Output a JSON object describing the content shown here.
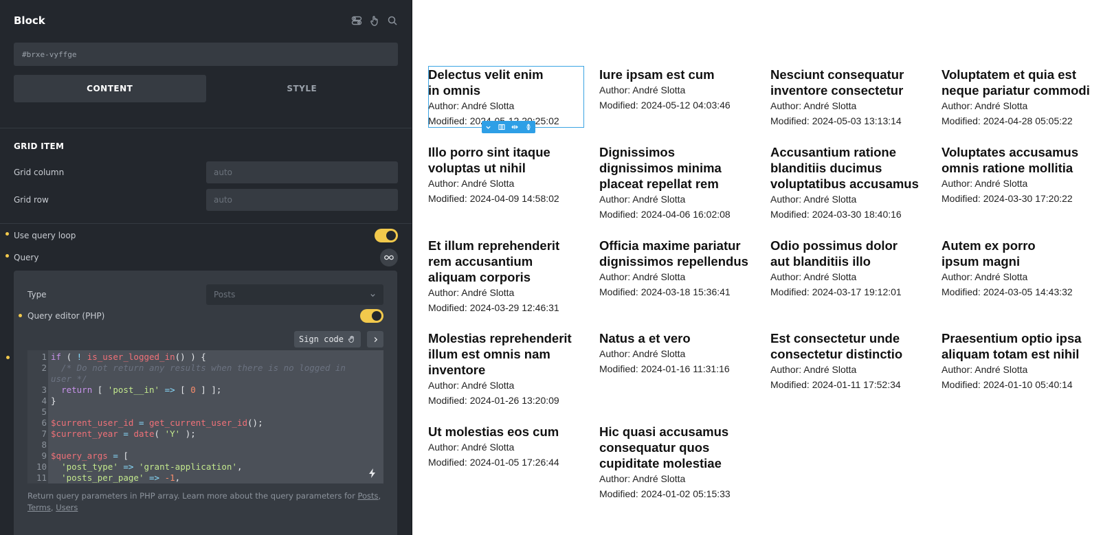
{
  "panel": {
    "title": "Block",
    "css_id": "#brxe-vyffge",
    "tabs": [
      {
        "label": "CONTENT"
      },
      {
        "label": "STYLE"
      }
    ],
    "grid_item": {
      "title": "GRID ITEM",
      "column_label": "Grid column",
      "column_placeholder": "auto",
      "row_label": "Grid row",
      "row_placeholder": "auto"
    },
    "use_query_loop": "Use query loop",
    "query": "Query",
    "type_label": "Type",
    "type_value": "Posts",
    "query_editor": "Query editor (PHP)",
    "sign_code": "Sign code",
    "help_text": "Return query parameters in PHP array. Learn more about the query parameters for",
    "help_links": [
      "Posts",
      "Terms",
      "Users"
    ]
  },
  "code": {
    "lines": [
      {
        "n": "1",
        "text": "if ( ! is_user_logged_in() ) {"
      },
      {
        "n": "2",
        "text": "  /* Do not return any results when there is no logged in"
      },
      {
        "n": "",
        "text": "user */"
      },
      {
        "n": "3",
        "text": "  return [ 'post__in' => [ 0 ] ];"
      },
      {
        "n": "4",
        "text": "}"
      },
      {
        "n": "5",
        "text": ""
      },
      {
        "n": "6",
        "text": "$current_user_id = get_current_user_id();"
      },
      {
        "n": "7",
        "text": "$current_year = date( 'Y' );"
      },
      {
        "n": "8",
        "text": ""
      },
      {
        "n": "9",
        "text": "$query_args = ["
      },
      {
        "n": "10",
        "text": "  'post_type' => 'grant-application',"
      },
      {
        "n": "11",
        "text": "  'posts_per_page' => -1,"
      }
    ]
  },
  "posts": [
    {
      "title": "Delectus velit enim in omnis",
      "author": "Author: André Slotta",
      "modified": "Modified: 2024-05-12 20:25:02"
    },
    {
      "title": "Iure ipsam est cum",
      "author": "Author: André Slotta",
      "modified": "Modified: 2024-05-12 04:03:46"
    },
    {
      "title": "Nesciunt consequatur inventore consectetur",
      "author": "Author: André Slotta",
      "modified": "Modified: 2024-05-03 13:13:14"
    },
    {
      "title": "Voluptatem et quia est neque pariatur commodi",
      "author": "Author: André Slotta",
      "modified": "Modified: 2024-04-28 05:05:22"
    },
    {
      "title": "Illo porro sint itaque voluptas ut nihil",
      "author": "Author: André Slotta",
      "modified": "Modified: 2024-04-09 14:58:02"
    },
    {
      "title": "Dignissimos dignissimos minima placeat repellat rem",
      "author": "Author: André Slotta",
      "modified": "Modified: 2024-04-06 16:02:08"
    },
    {
      "title": "Accusantium ratione blanditiis ducimus voluptatibus accusamus",
      "author": "Author: André Slotta",
      "modified": "Modified: 2024-03-30 18:40:16"
    },
    {
      "title": "Voluptates accusamus omnis ratione mollitia",
      "author": "Author: André Slotta",
      "modified": "Modified: 2024-03-30 17:20:22"
    },
    {
      "title": "Et illum reprehenderit rem accusantium aliquam corporis",
      "author": "Author: André Slotta",
      "modified": "Modified: 2024-03-29 12:46:31"
    },
    {
      "title": "Officia maxime pariatur dignissimos repellendus",
      "author": "Author: André Slotta",
      "modified": "Modified: 2024-03-18 15:36:41"
    },
    {
      "title": "Odio possimus dolor aut blanditiis illo",
      "author": "Author: André Slotta",
      "modified": "Modified: 2024-03-17 19:12:01"
    },
    {
      "title": "Autem ex porro ipsum magni",
      "author": "Author: André Slotta",
      "modified": "Modified: 2024-03-05 14:43:32"
    },
    {
      "title": "Molestias reprehenderit illum est omnis nam inventore",
      "author": "Author: André Slotta",
      "modified": "Modified: 2024-01-26 13:20:09"
    },
    {
      "title": "Natus a et vero",
      "author": "Author: André Slotta",
      "modified": "Modified: 2024-01-16 11:31:16"
    },
    {
      "title": "Est consectetur unde consectetur distinctio",
      "author": "Author: André Slotta",
      "modified": "Modified: 2024-01-11 17:52:34"
    },
    {
      "title": "Praesentium optio ipsa aliquam totam est nihil",
      "author": "Author: André Slotta",
      "modified": "Modified: 2024-01-10 05:40:14"
    },
    {
      "title": "Ut molestias eos cum",
      "author": "Author: André Slotta",
      "modified": "Modified: 2024-01-05 17:26:44"
    },
    {
      "title": "Hic quasi accusamus consequatur quos cupiditate molestiae",
      "author": "Author: André Slotta",
      "modified": "Modified: 2024-01-02 05:15:33"
    }
  ],
  "colors": {
    "accent": "#f2c94c",
    "selection": "#3aa3e3",
    "panel_bg": "#23272d"
  }
}
